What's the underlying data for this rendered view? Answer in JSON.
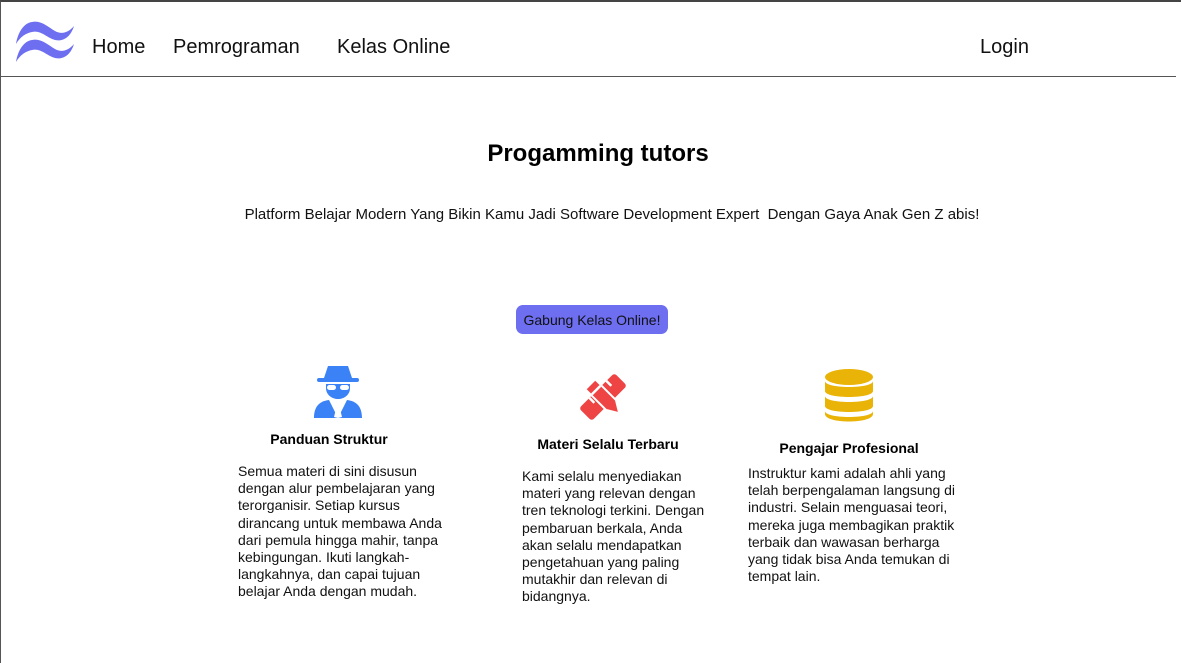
{
  "nav": {
    "items": [
      "Home",
      "Pemrograman",
      "Kelas Online"
    ],
    "login_label": "Login"
  },
  "hero": {
    "title": "Progamming tutors",
    "subtitle": "Platform Belajar Modern Yang Bikin Kamu Jadi Software Development Expert  Dengan Gaya Anak Gen Z abis!",
    "cta_label": "Gabung Kelas Online!"
  },
  "features": [
    {
      "icon": "spy-icon",
      "title": "Panduan Struktur",
      "description": "Semua materi di sini disusun dengan alur pembelajaran yang terorganisir. Setiap kursus dirancang untuk membawa Anda dari pemula hingga mahir, tanpa kebingungan. Ikuti langkah-langkahnya, dan capai tujuan belajar Anda dengan mudah."
    },
    {
      "icon": "pencil-ruler-icon",
      "title": "Materi Selalu Terbaru",
      "description": "Kami selalu menyediakan materi yang relevan dengan tren teknologi terkini. Dengan pembaruan berkala, Anda akan selalu mendapatkan pengetahuan yang paling mutakhir dan relevan di bidangnya."
    },
    {
      "icon": "database-icon",
      "title": "Pengajar Profesional",
      "description": "Instruktur kami adalah ahli yang telah berpengalaman langsung di industri. Selain menguasai teori, mereka juga membagikan praktik terbaik dan wawasan berharga yang tidak bisa Anda temukan di tempat lain."
    }
  ],
  "colors": {
    "accent": "#6d6ef0",
    "spy_icon": "#3b82f6",
    "pencil_icon": "#ef4444",
    "database_icon": "#eab308"
  }
}
